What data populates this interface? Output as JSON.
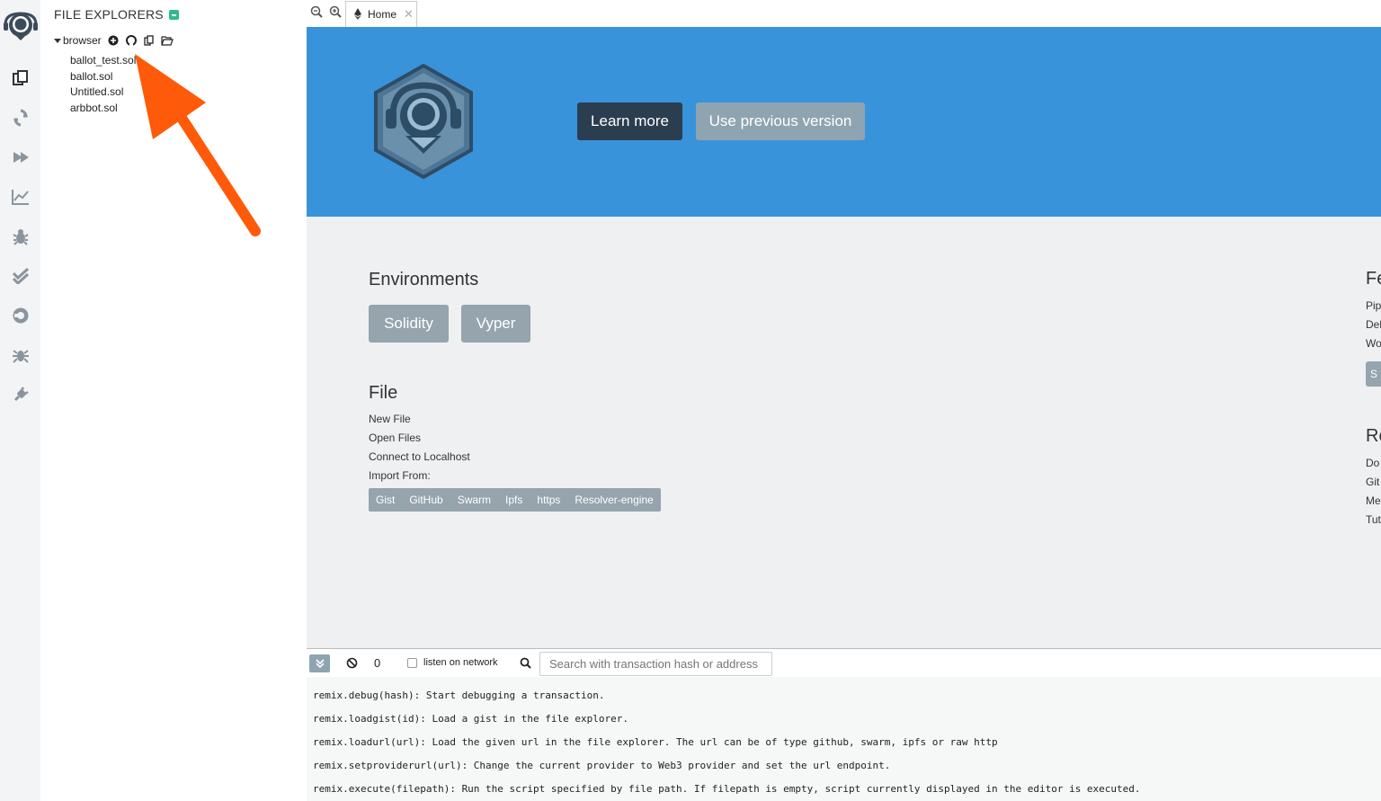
{
  "sidebar": {
    "title": "FILE EXPLORERS",
    "root": "browser",
    "files": [
      "ballot_test.sol",
      "ballot.sol",
      "Untitled.sol",
      "arbbot.sol"
    ]
  },
  "icon_bar": [
    "remix-logo-icon",
    "file-explorer-icon",
    "compiler-icon",
    "deploy-icon",
    "analysis-icon",
    "debugger-icon",
    "test-icon",
    "support-icon",
    "plugin-bug-icon",
    "plugin-manager-icon"
  ],
  "tabs": [
    {
      "label": "Home"
    }
  ],
  "hero": {
    "learn_more": "Learn more",
    "use_previous": "Use previous version"
  },
  "environments": {
    "title": "Environments",
    "buttons": [
      "Solidity",
      "Vyper"
    ]
  },
  "file_section": {
    "title": "File",
    "links": [
      "New File",
      "Open Files",
      "Connect to Localhost",
      "Import From:"
    ],
    "import_sources": [
      "Gist",
      "GitHub",
      "Swarm",
      "Ipfs",
      "https",
      "Resolver-engine"
    ]
  },
  "right_column": {
    "featured_title": "Fe",
    "featured_items": [
      "Pip",
      "Del",
      "Wo"
    ],
    "featured_btn": "S",
    "resources_title": "Re",
    "resources_items": [
      "Do",
      "Git",
      "Me",
      "Tut"
    ]
  },
  "terminal": {
    "count": "0",
    "listen_label": "listen on network",
    "search_placeholder": "Search with transaction hash or address",
    "lines": [
      "remix.debug(hash): Start debugging a transaction.",
      "remix.loadgist(id): Load a gist in the file explorer.",
      "remix.loadurl(url): Load the given url in the file explorer. The url can be of type github, swarm, ipfs or raw http",
      "remix.setproviderurl(url): Change the current provider to Web3 provider and set the url endpoint.",
      "remix.execute(filepath): Run the script specified by file path. If filepath is empty, script currently displayed in the editor is executed."
    ]
  },
  "colors": {
    "hero_blue": "#3893da",
    "annotation_arrow": "#ff5a0a"
  }
}
